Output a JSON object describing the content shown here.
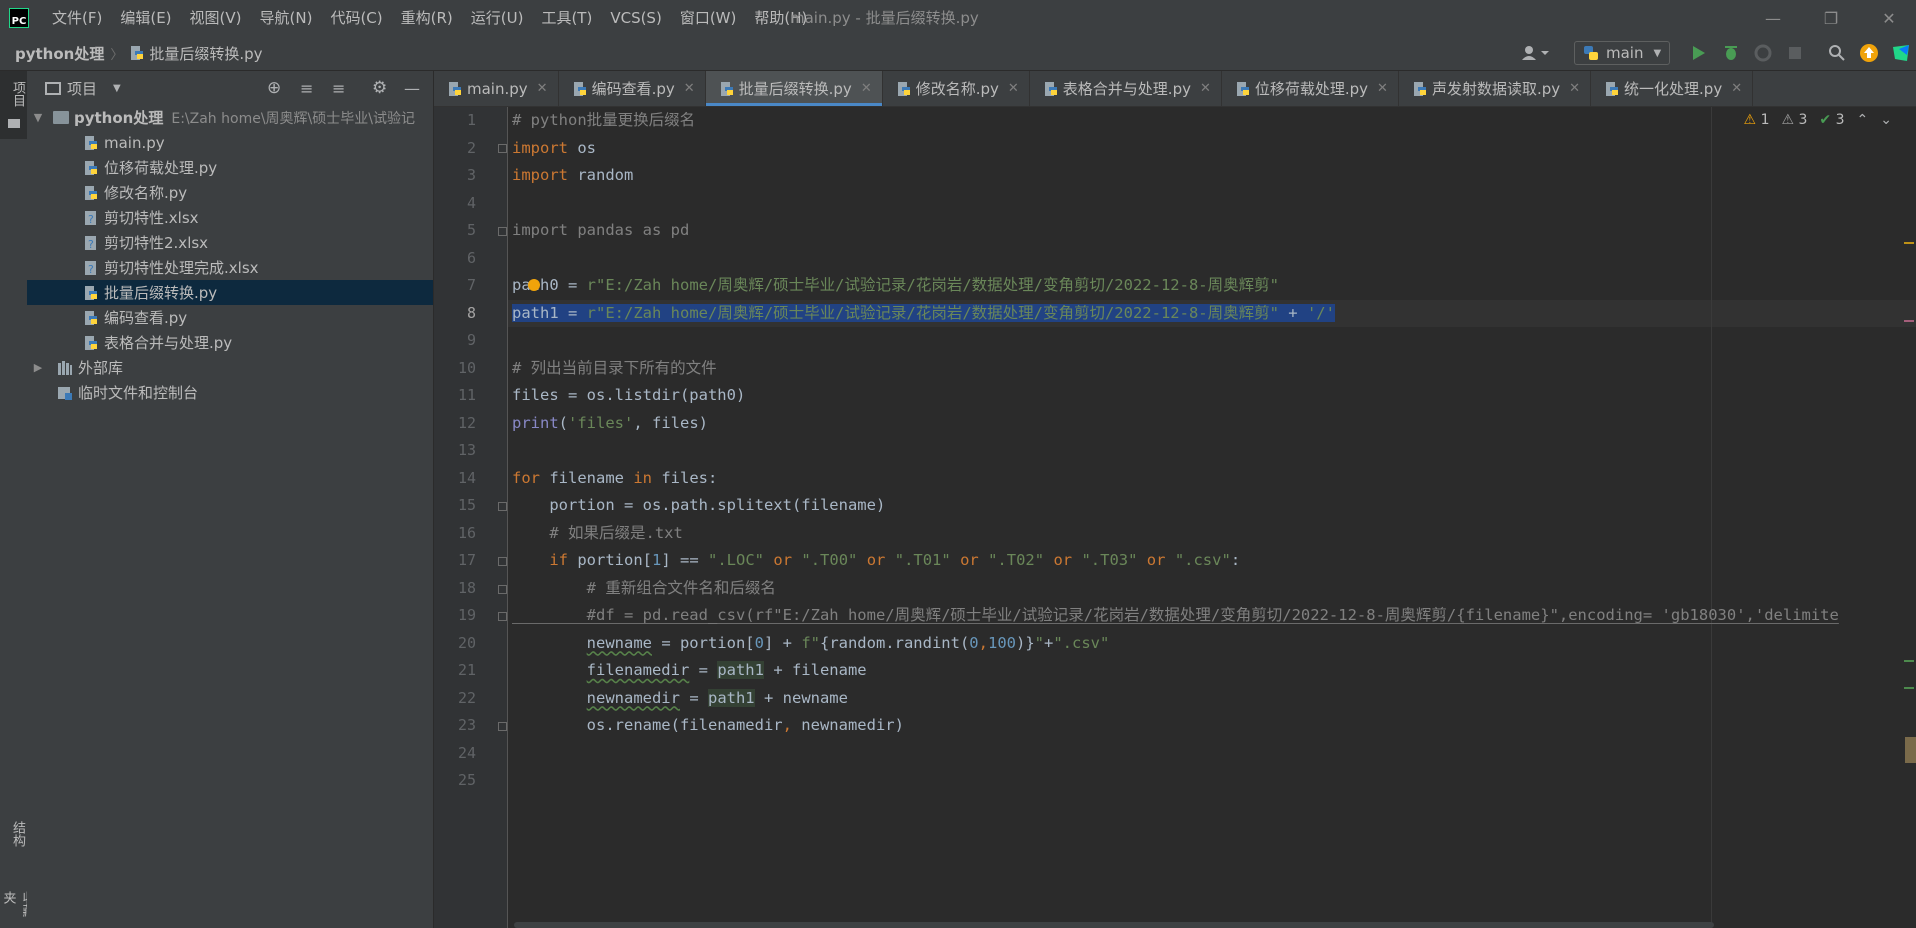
{
  "app": {
    "logo_text": "PC",
    "window_title": "main.py - 批量后缀转换.py"
  },
  "menu": [
    "文件(F)",
    "编辑(E)",
    "视图(V)",
    "导航(N)",
    "代码(C)",
    "重构(R)",
    "运行(U)",
    "工具(T)",
    "VCS(S)",
    "窗口(W)",
    "帮助(H)"
  ],
  "navbar": {
    "project": "python处理",
    "current_file": "批量后缀转换.py",
    "run_config": "main"
  },
  "left_strip": {
    "project_tab": "项目",
    "structure_tab": "结构",
    "bookmarks_tab": "收藏夹"
  },
  "project_panel": {
    "title": "项目",
    "root": {
      "name": "python处理",
      "path": "E:\\Zah home\\周奥辉\\硕士毕业\\试验记"
    },
    "files": [
      "main.py",
      "位移荷载处理.py",
      "修改名称.py",
      "剪切特性.xlsx",
      "剪切特性2.xlsx",
      "剪切特性处理完成.xlsx",
      "批量后缀转换.py",
      "编码查看.py",
      "表格合并与处理.py"
    ],
    "selected_index": 6,
    "external_libs": "外部库",
    "scratches": "临时文件和控制台"
  },
  "tabs": [
    "main.py",
    "编码查看.py",
    "批量后缀转换.py",
    "修改名称.py",
    "表格合并与处理.py",
    "位移荷载处理.py",
    "声发射数据读取.py",
    "统一化处理.py"
  ],
  "active_tab": 2,
  "inspections": {
    "errors": "1",
    "warnings": "3",
    "ok": "3"
  },
  "code": {
    "line_numbers": [
      "1",
      "2",
      "3",
      "4",
      "5",
      "6",
      "7",
      "8",
      "9",
      "10",
      "11",
      "12",
      "13",
      "14",
      "15",
      "16",
      "17",
      "18",
      "19",
      "20",
      "21",
      "22",
      "23",
      "24",
      "25"
    ],
    "l1": "# python批量更换后缀名",
    "l2_kw": "import",
    "l2_rest": " os",
    "l3_kw": "import",
    "l3_rest": " random",
    "l5": "import pandas as pd",
    "l7_var": "path0",
    "l7_eq": " = ",
    "l7_str": "r\"E:/Zah home/周奥辉/硕士毕业/试验记录/花岗岩/数据处理/变角剪切/2022-12-8-周奥辉剪\"",
    "l8_var": "path1",
    "l8_eq": " = ",
    "l8_str": "r\"E:/Zah home/周奥辉/硕士毕业/试验记录/花岗岩/数据处理/变角剪切/2022-12-8-周奥辉剪\"",
    "l8_plus": " + ",
    "l8_str2": "'/'",
    "l10": "# 列出当前目录下所有的文件",
    "l11": "files = os.listdir(path0)",
    "l12_fn": "print",
    "l12_a": "(",
    "l12_str": "'files'",
    "l12_b": ", files)",
    "l14_kw": "for",
    "l14_a": " filename ",
    "l14_kw2": "in",
    "l14_b": " files:",
    "l15": "    portion = os.path.splitext(filename)",
    "l16": "    # 如果后缀是.txt",
    "l17_kw": "    if",
    "l17_a": " portion[",
    "l17_n": "1",
    "l17_b": "] == ",
    "l17_s1": "\".LOC\"",
    "l17_s2": "\".T00\"",
    "l17_s3": "\".T01\"",
    "l17_s4": "\".T02\"",
    "l17_s5": "\".T03\"",
    "l17_s6": "\".csv\"",
    "l17_or": "or",
    "l17_end": ":",
    "l18": "        # 重新组合文件名和后缀名",
    "l19": "        #df = pd.read_csv(rf\"E:/Zah home/周奥辉/硕士毕业/试验记录/花岗岩/数据处理/变角剪切/2022-12-8-周奥辉剪/{filename}\",encoding= 'gb18030','delimite",
    "l20_var": "newname",
    "l20_a": " = portion[",
    "l20_n": "0",
    "l20_b": "] + ",
    "l20_f": "f\"",
    "l20_c": "{random.randint(",
    "l20_n2": "0",
    "l20_comma": ",",
    "l20_n3": "100",
    "l20_d": ")}",
    "l20_e": "\"",
    "l20_plus": "+",
    "l20_s": "\".csv\"",
    "l21_var": "filenamedir",
    "l21_a": " = ",
    "l21_p": "path1",
    "l21_b": " + filename",
    "l22_var": "newnamedir",
    "l22_a": " = ",
    "l22_p": "path1",
    "l22_b": " + newname",
    "l23_a": "        os.rename(filenamedir",
    "l23_comma": ",",
    "l23_b": " newnamedir)"
  },
  "colors": {
    "keyword": "#cc7832",
    "string": "#6a8759",
    "comment": "#808080",
    "number": "#6897bb",
    "selection": "#214283",
    "accent": "#4a88c7"
  }
}
